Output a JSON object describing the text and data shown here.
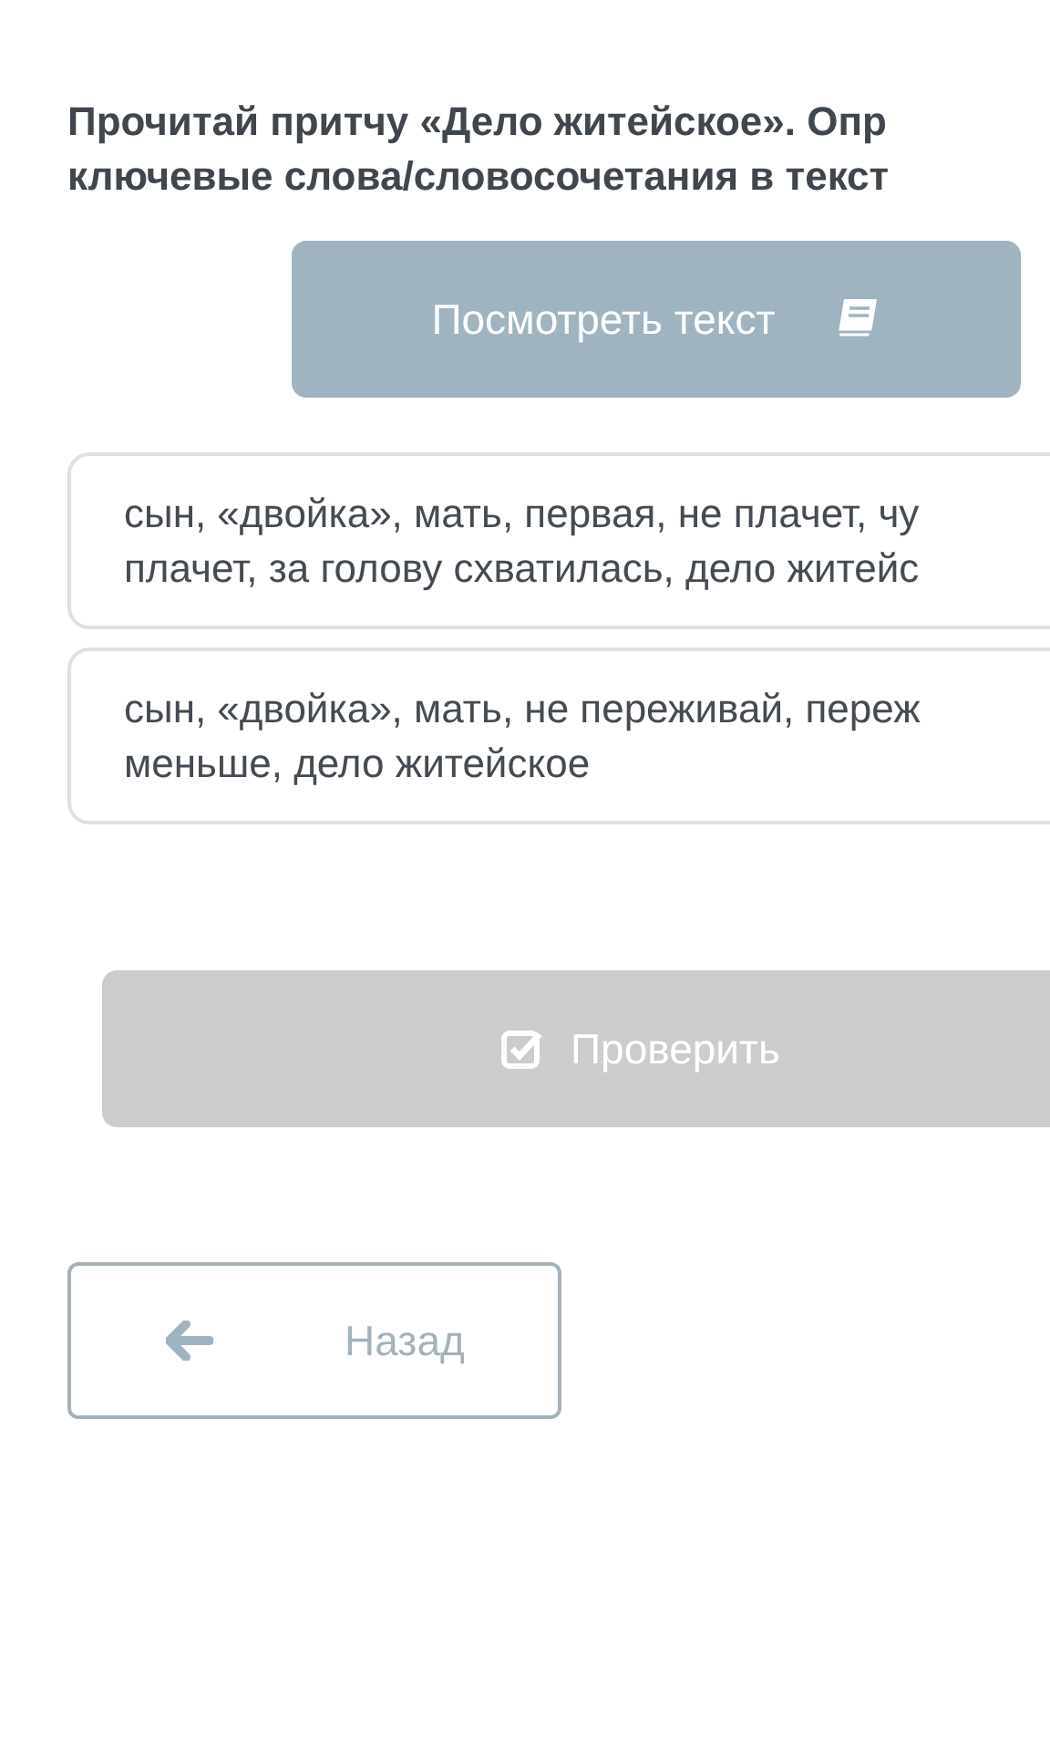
{
  "question": {
    "lines": [
      "Прочитай притчу «Дело житейское». Опр",
      "ключевые слова/словосочетания в текст"
    ]
  },
  "view_text_button": {
    "label": "Посмотреть текст"
  },
  "options": [
    {
      "lines": [
        "сын, «двойка», мать, первая, не плачет, чу",
        "плачет, за голову схватилась, дело житейс"
      ],
      "selected": false
    },
    {
      "lines": [
        "сын, «двойка», мать, не переживай, переж",
        "меньше, дело житейское"
      ],
      "selected": false
    }
  ],
  "check_button": {
    "label": "Проверить",
    "disabled": true
  },
  "back_button": {
    "label": "Назад"
  }
}
